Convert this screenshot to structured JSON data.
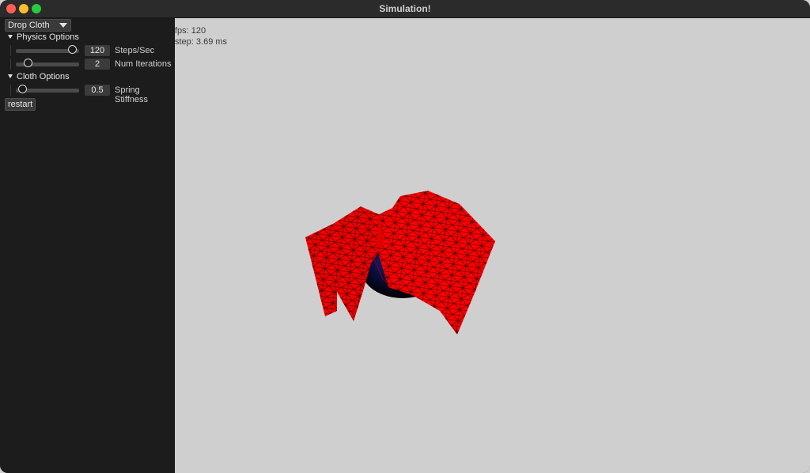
{
  "window": {
    "title": "Simulation!"
  },
  "sidebar": {
    "dropdown": {
      "selected": "Drop Cloth"
    },
    "physics": {
      "header": "Physics Options",
      "steps": {
        "value": "120",
        "label": "Steps/Sec",
        "level": 0.95
      },
      "iterations": {
        "value": "2",
        "label": "Num Iterations",
        "level": 0.15
      }
    },
    "cloth": {
      "header": "Cloth Options",
      "stiffness": {
        "value": "0.5",
        "label": "Spring Stiffness",
        "level": 0.05
      }
    },
    "restart_label": "restart"
  },
  "viewport": {
    "fps": "fps: 120",
    "step": "step: 3.69 ms",
    "colors": {
      "cloth": "#ff0000",
      "mesh_lines": "#2a0000",
      "sphere": "#070a2a",
      "background": "#cfcfcf"
    }
  }
}
